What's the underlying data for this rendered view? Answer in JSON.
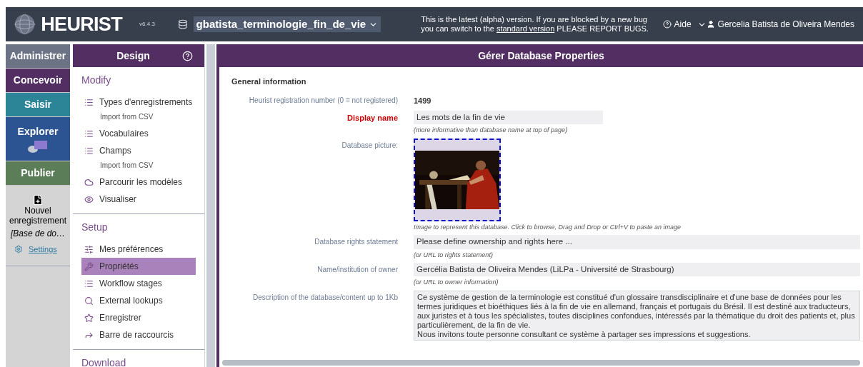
{
  "header": {
    "logo": "HEURIST",
    "version": "v6.4.3",
    "database": "gbatista_terminologie_fin_de_vie",
    "notice_before": "This is the latest (alpha) version. If you are blocked by a new bug you can switch to the ",
    "notice_link": "standard version",
    "notice_after": " PLEASE REPORT BUGS.",
    "help": "Aide",
    "user": "Gercelia Batista de Oliveira Mendes"
  },
  "nav": [
    {
      "label": "Administrer",
      "color": "#6b7385",
      "kind": "text"
    },
    {
      "label": "Concevoir",
      "color": "#532e63",
      "kind": "text"
    },
    {
      "label": "Saisir",
      "color": "#2c8597",
      "kind": "text"
    },
    {
      "label": "Explorer",
      "color": "#2d5492",
      "kind": "icon"
    },
    {
      "label": "Publier",
      "color": "#5b7d58",
      "kind": "text"
    }
  ],
  "new_record": {
    "label": "Nouvel enregistrement",
    "database": "[Base de do…",
    "settings": "Settings"
  },
  "design_panel": {
    "title": "Design",
    "sections": [
      {
        "title": "Modify",
        "items": [
          {
            "label": "Types d'enregistrements",
            "kind": "list",
            "sub": "Import from CSV",
            "selected": false
          },
          {
            "label": "Vocabulaires",
            "kind": "list",
            "selected": false
          },
          {
            "label": "Champs",
            "kind": "list",
            "sub": "Import from CSV",
            "selected": false
          },
          {
            "label": "Parcourir les modèles",
            "kind": "cloud",
            "selected": false
          },
          {
            "label": "Visualiser",
            "kind": "eye",
            "selected": false
          }
        ]
      },
      {
        "title": "Setup",
        "items": [
          {
            "label": "Mes préférences",
            "kind": "sliders",
            "selected": false
          },
          {
            "label": "Propriétés",
            "kind": "wrench",
            "selected": true
          },
          {
            "label": "Workflow stages",
            "kind": "list",
            "selected": false
          },
          {
            "label": "External lookups",
            "kind": "search",
            "selected": false
          },
          {
            "label": "Enregistrer",
            "kind": "star",
            "selected": false
          },
          {
            "label": "Barre de raccourcis",
            "kind": "share",
            "selected": false
          }
        ]
      },
      {
        "title": "Download"
      }
    ]
  },
  "main": {
    "title": "Gérer Database Properties",
    "section": "General information",
    "fields": [
      {
        "kind": "static",
        "label": "Heurist registration number (0 = not registered)",
        "value": "1499"
      },
      {
        "kind": "short-input",
        "label": "Display name",
        "required": true,
        "value": "Les mots de la fin de vie",
        "hint": "(more informative than database name at top of page)"
      },
      {
        "kind": "picture",
        "label": "Database picture:",
        "hint": "Image to represent this database. Click to browse, Drag and Drop or Ctrl+V to paste an image"
      },
      {
        "kind": "input",
        "label": "Database rights statement",
        "required": false,
        "value": "Please define ownership and rights here ...",
        "hint": "(or URL to rights statement)"
      },
      {
        "kind": "input",
        "label": "Name/institution of owner",
        "required": false,
        "value": "Gercélia Batista de Oliveira Mendes (LiLPa - Université de Strasbourg)",
        "hint": "(or URL to owner information)"
      },
      {
        "kind": "textarea",
        "label": "Description of the database/content up to 1Kb",
        "value": "Ce système de gestion de la terminologie est constitué d'un glossaire transdisciplinaire et d'une base de données pour les termes juridiques et bioéthiques liés à la fin de vie en allemand, français et portugais du Brésil. Il est destiné aux traducteurs, aux juristes et à tous les spécialistes, toutes disciplines confondues, intéressés par la thématique du droit des patients et, plus particulièrement, de la fin de vie.\nNous invitons toute personne consultant ce système à partager ses impressions et suggestions."
      }
    ]
  }
}
